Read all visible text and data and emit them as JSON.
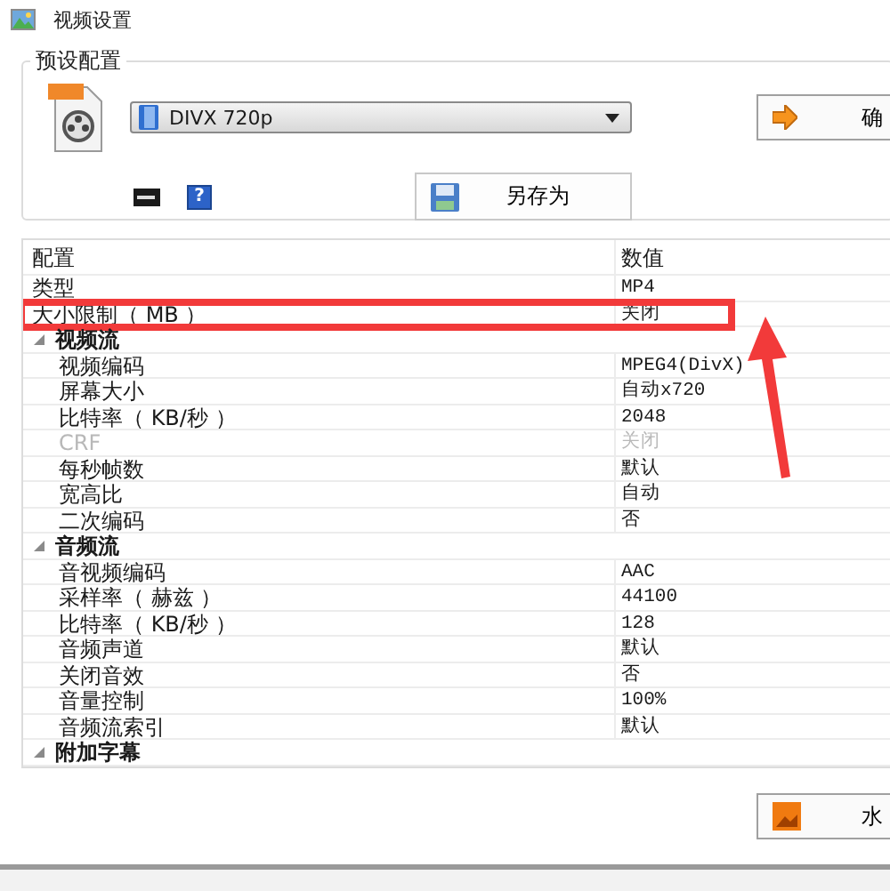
{
  "window": {
    "title": "视频设置"
  },
  "preset": {
    "legend": "预设配置",
    "profile": "DIVX 720p",
    "help": "?",
    "save_as": "另存为",
    "ok": "确"
  },
  "grid": {
    "columns": [
      "配置",
      "数值"
    ],
    "rows": [
      {
        "kind": "row",
        "label": "类型",
        "value": "MP4",
        "disabled": false,
        "highlighted": false
      },
      {
        "kind": "row",
        "label": "大小限制（ MB ）",
        "value": "关闭",
        "disabled": false,
        "highlighted": true
      },
      {
        "kind": "category",
        "label": "视频流",
        "expanded": true,
        "children": [
          {
            "kind": "row",
            "label": "视频编码",
            "value": "MPEG4(DivX)",
            "disabled": false,
            "highlighted": false
          },
          {
            "kind": "row",
            "label": "屏幕大小",
            "value": "自动x720",
            "disabled": false,
            "highlighted": false
          },
          {
            "kind": "row",
            "label": "比特率（ KB/秒 ）",
            "value": "2048",
            "disabled": false,
            "highlighted": false
          },
          {
            "kind": "row",
            "label": "CRF",
            "value": "关闭",
            "disabled": true,
            "highlighted": false
          },
          {
            "kind": "row",
            "label": "每秒帧数",
            "value": "默认",
            "disabled": false,
            "highlighted": false
          },
          {
            "kind": "row",
            "label": "宽高比",
            "value": "自动",
            "disabled": false,
            "highlighted": false
          },
          {
            "kind": "row",
            "label": "二次编码",
            "value": "否",
            "disabled": false,
            "highlighted": false
          }
        ]
      },
      {
        "kind": "category",
        "label": "音频流",
        "expanded": true,
        "children": [
          {
            "kind": "row",
            "label": "音视频编码",
            "value": "AAC",
            "disabled": false,
            "highlighted": false
          },
          {
            "kind": "row",
            "label": "采样率（ 赫兹 ）",
            "value": "44100",
            "disabled": false,
            "highlighted": false
          },
          {
            "kind": "row",
            "label": "比特率（ KB/秒 ）",
            "value": "128",
            "disabled": false,
            "highlighted": false
          },
          {
            "kind": "row",
            "label": "音频声道",
            "value": "默认",
            "disabled": false,
            "highlighted": false
          },
          {
            "kind": "row",
            "label": "关闭音效",
            "value": "否",
            "disabled": false,
            "highlighted": false
          },
          {
            "kind": "row",
            "label": "音量控制",
            "value": "100%",
            "disabled": false,
            "highlighted": false
          },
          {
            "kind": "row",
            "label": "音频流索引",
            "value": "默认",
            "disabled": false,
            "highlighted": false
          }
        ]
      },
      {
        "kind": "category",
        "label": "附加字幕",
        "expanded": true
      }
    ]
  },
  "footer": {
    "button": "水"
  },
  "annotation": {
    "kind": "box-and-arrow"
  }
}
